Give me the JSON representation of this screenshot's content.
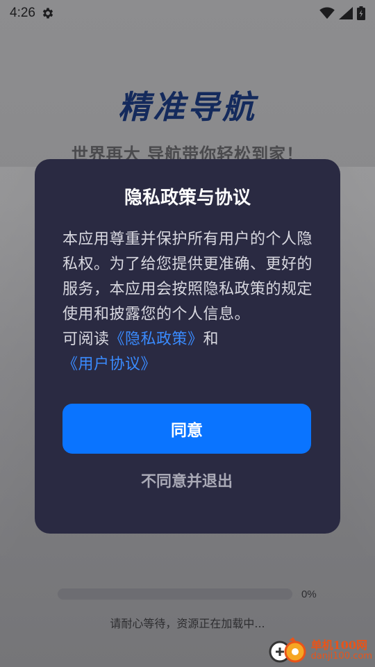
{
  "status_bar": {
    "time": "4:26",
    "icons": [
      "gear-icon",
      "wifi-icon",
      "signal-icon",
      "battery-icon"
    ]
  },
  "brand": {
    "title": "精准导航",
    "slogan": "世界再大 导航带你轻松到家！"
  },
  "dialog": {
    "title": "隐私政策与协议",
    "body": "本应用尊重并保护所有用户的个人隐私权。为了给您提供更准确、更好的服务，本应用会按照隐私政策的规定使用和披露您的个人信息。",
    "read_prefix": "可阅读",
    "privacy_link": "《隐私政策》",
    "and_text": "和",
    "agreement_link": "《用户协议》",
    "agree_label": "同意",
    "disagree_label": "不同意并退出"
  },
  "loading": {
    "progress": 0,
    "progress_label": "0%",
    "message": "请耐心等待，资源正在加载中..."
  },
  "watermark": {
    "name": "单机100网",
    "url": "danji100.com"
  },
  "colors": {
    "accent": "#0a74ff",
    "link": "#3a8bff",
    "dialog_bg": "#2a2a42",
    "brand_title": "#142a5c",
    "watermark": "#e8541a"
  }
}
